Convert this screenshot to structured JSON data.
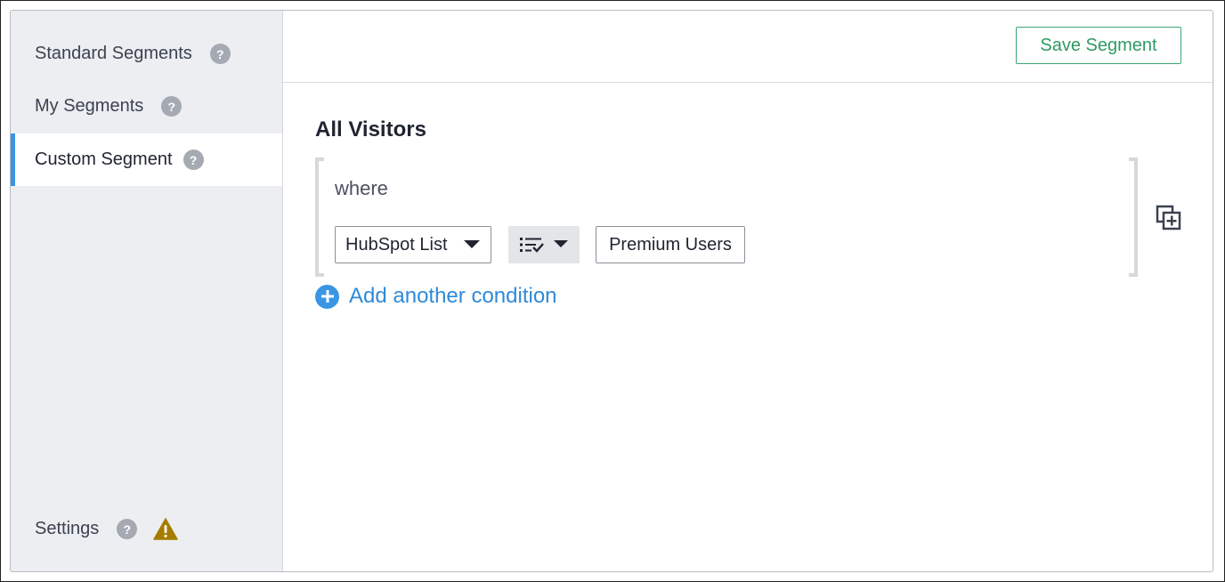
{
  "sidebar": {
    "items": [
      {
        "label": "Standard Segments",
        "help": "?"
      },
      {
        "label": "My Segments",
        "help": "?"
      },
      {
        "label": "Custom Segment",
        "help": "?",
        "active": true
      }
    ],
    "settings": {
      "label": "Settings",
      "help": "?",
      "warning_icon": "warning-triangle-icon"
    }
  },
  "header": {
    "save_label": "Save Segment"
  },
  "segment": {
    "title": "All Visitors",
    "condition": {
      "where_label": "where",
      "field": "HubSpot List",
      "operator_icon": "list-check-icon",
      "value": "Premium Users"
    },
    "add_condition_label": "Add another condition",
    "duplicate_icon": "duplicate-icon"
  },
  "colors": {
    "accent": "#3a95e4",
    "save_green": "#2f9a63",
    "warning": "#a67c00",
    "sidebar_bg": "#eceef1"
  }
}
